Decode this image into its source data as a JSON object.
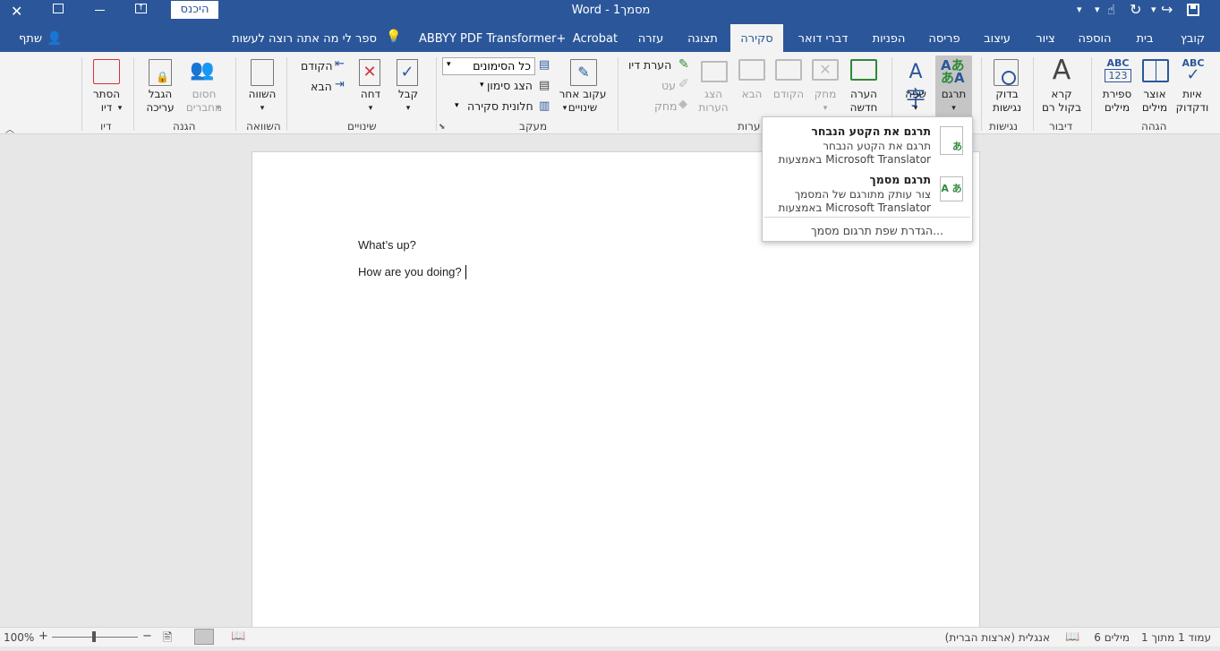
{
  "titlebar": {
    "title": "Word  -  מסמך1",
    "signin_label": "היכנס"
  },
  "tabs": [
    "קובץ",
    "בית",
    "הוספה",
    "ציור",
    "עיצוב",
    "פריסה",
    "הפניות",
    "דברי דואר",
    "סקירה",
    "תצוגה",
    "עזרה",
    "Acrobat",
    "ABBYY PDF Transformer+"
  ],
  "tell_me": "ספר לי מה אתה רוצה לעשות",
  "share_label": "שתף",
  "ribbon": {
    "proofing": {
      "group": "הגהה",
      "spelling": "איות\nודקדוק",
      "thesaurus": "אוצר\nמילים",
      "wordcount": "ספירת\nמילים"
    },
    "speech": {
      "group": "דיבור",
      "read_aloud": "קרא\nבקול רם"
    },
    "accessibility": {
      "group": "נגישות",
      "check": "בדוק\nנגישות"
    },
    "language": {
      "translate": "תרגם",
      "language": "שפה"
    },
    "comments": {
      "group": "ערות",
      "new": "הערה\nחדשה",
      "delete": "מחק",
      "previous": "הקודם",
      "next": "הבא",
      "show": "הצג\nהערות"
    },
    "ink": {
      "ink_comment": "הערת דיו",
      "pen": "עט",
      "eraser": "מחק"
    },
    "tracking": {
      "group": "מעקב",
      "track": "עקוב אחר\nשינויים",
      "markup_value": "כל הסימונים",
      "show_markup": "הצג סימון",
      "review_pane": "חלונית סקירה"
    },
    "changes": {
      "group": "שינויים",
      "accept": "קבל",
      "reject": "דחה",
      "previous": "הקודם",
      "next": "הבא"
    },
    "compare": {
      "group": "השוואה",
      "compare": "השווה"
    },
    "protect": {
      "group": "הגנה",
      "block_authors": "חסום\nמחברים",
      "restrict": "הגבל\nעריכה"
    },
    "ink_group": {
      "group": "דיו",
      "hide_ink": "הסתר\nדיו"
    }
  },
  "dropdown": {
    "item1_title": "תרגם את הקטע הנבחר",
    "item1_desc1": "תרגם את הקטע הנבחר",
    "item1_desc2": "באמצעות Microsoft Translator",
    "item2_title": "תרגם מסמך",
    "item2_desc1": "צור עותק מתורגם של המסמך",
    "item2_desc2": "באמצעות Microsoft Translator",
    "item3": "הגדרת שפת תרגום מסמך..."
  },
  "document": {
    "line1": "What’s up?",
    "line2": "How are you doing?"
  },
  "status": {
    "page": "עמוד 1 מתוך 1",
    "words": "6 מילים",
    "language": "אנגלית (ארצות הברית)",
    "zoom": "100%"
  },
  "colors": {
    "accent": "#2b579a",
    "ribbon": "#f3f3f3",
    "doc_bg": "#e7e7e7"
  }
}
